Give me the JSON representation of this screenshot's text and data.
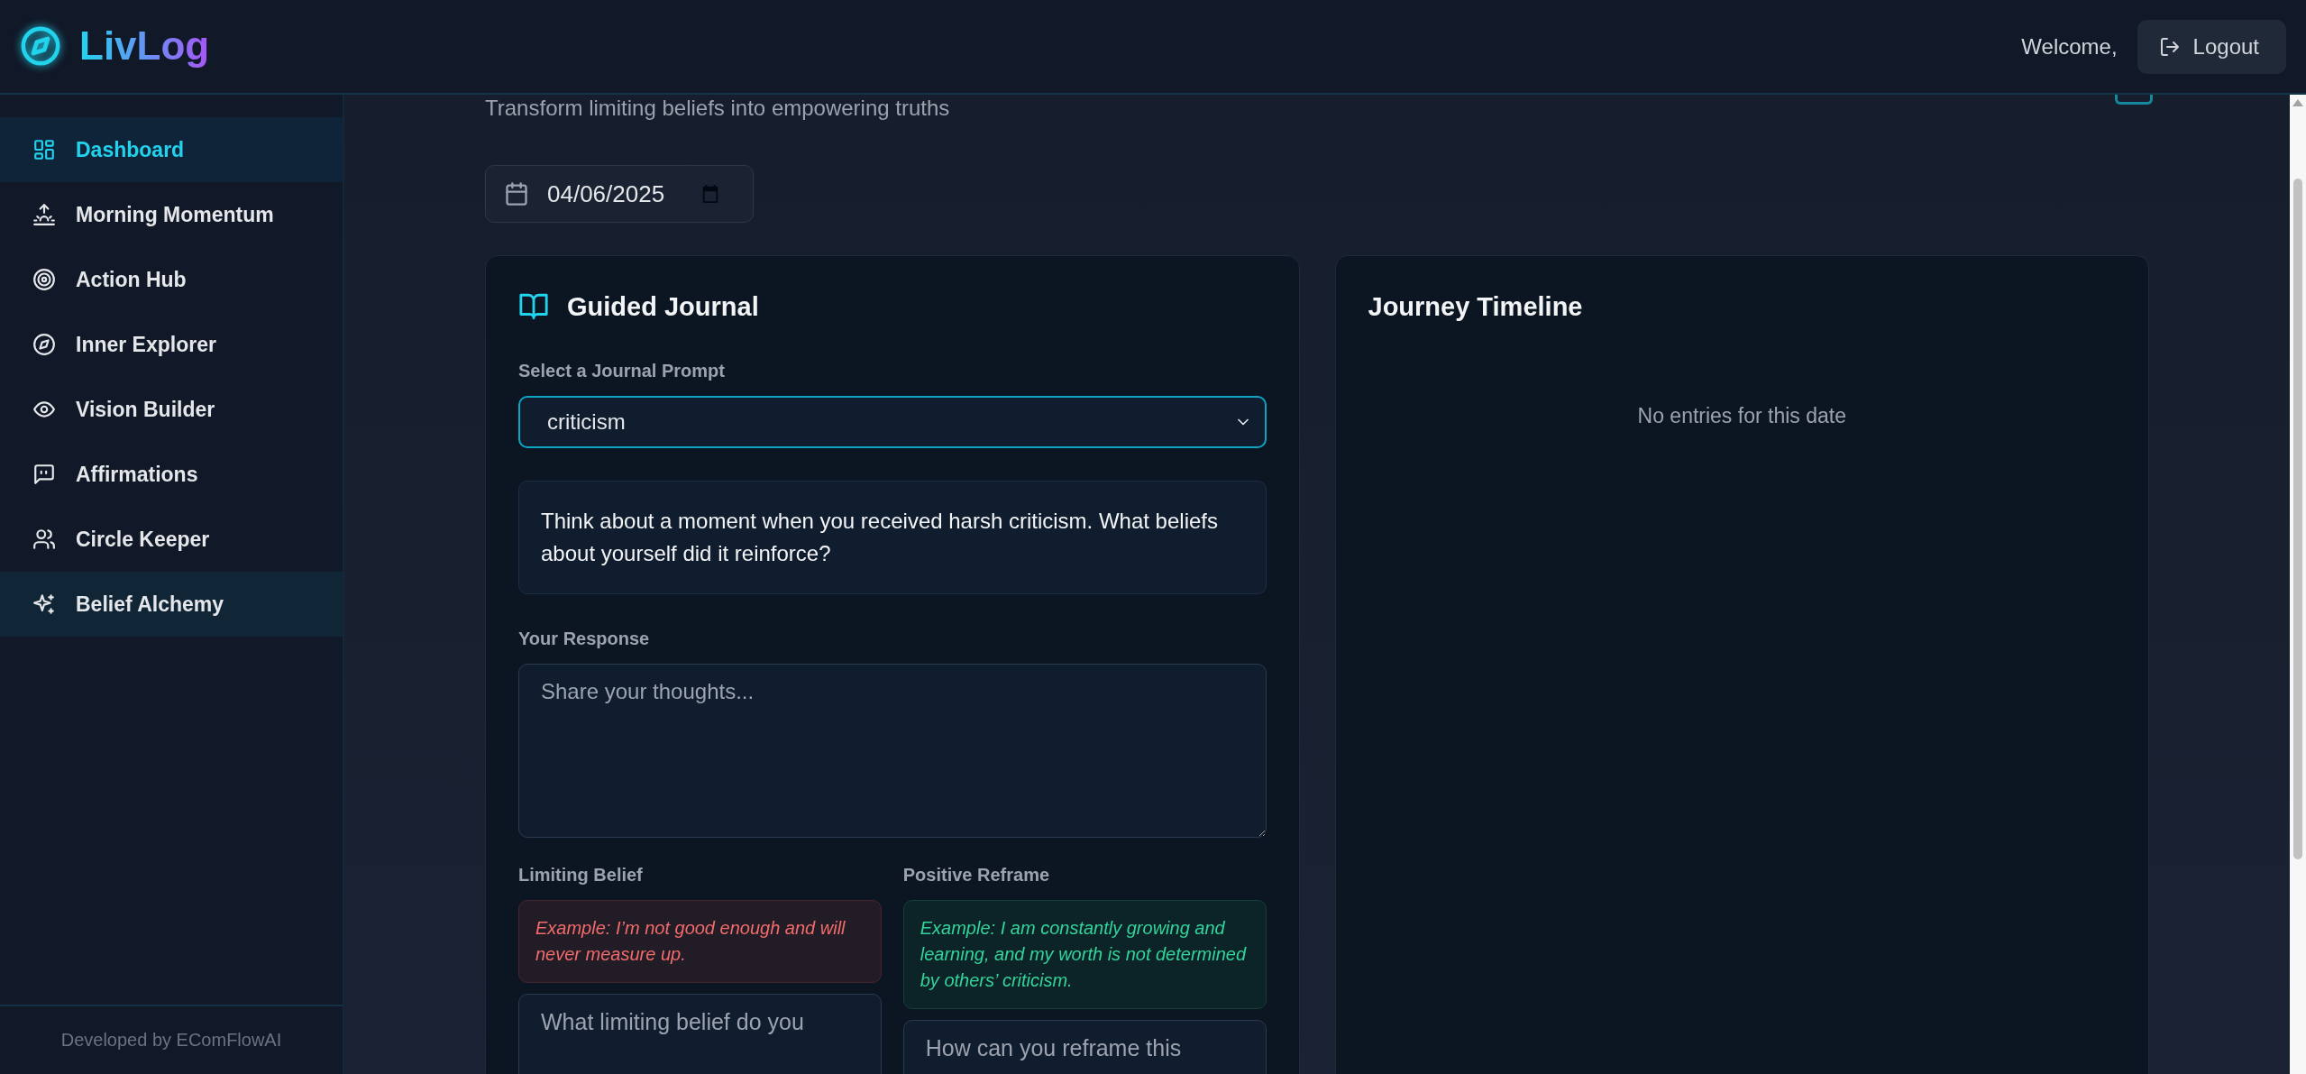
{
  "header": {
    "logo": "LivLog",
    "welcome": "Welcome,",
    "logout": "Logout"
  },
  "sidebar": {
    "items": [
      {
        "label": "Dashboard",
        "selected": true,
        "hovered": false
      },
      {
        "label": "Morning Momentum",
        "selected": false,
        "hovered": false
      },
      {
        "label": "Action Hub",
        "selected": false,
        "hovered": false
      },
      {
        "label": "Inner Explorer",
        "selected": false,
        "hovered": false
      },
      {
        "label": "Vision Builder",
        "selected": false,
        "hovered": false
      },
      {
        "label": "Affirmations",
        "selected": false,
        "hovered": false
      },
      {
        "label": "Circle Keeper",
        "selected": false,
        "hovered": false
      },
      {
        "label": "Belief Alchemy",
        "selected": false,
        "hovered": true
      }
    ],
    "footer": "Developed by EComFlowAI"
  },
  "page": {
    "subtitle": "Transform limiting beliefs into empowering truths",
    "date_field": {
      "value": "04/06/2025"
    }
  },
  "journal": {
    "title": "Guided Journal",
    "prompt_label": "Select a Journal Prompt",
    "prompt_select": {
      "value": "criticism"
    },
    "prompt_text": "Think about a moment when you received harsh criticism. What beliefs about yourself did it reinforce?",
    "response_label": "Your Response",
    "response_field": {
      "placeholder": "Share your thoughts..."
    },
    "columns": [
      {
        "kind": "limiting",
        "label": "Limiting Belief",
        "example": "Example: I’m not good enough and will never measure up.",
        "field": {
          "placeholder": "What limiting belief do you"
        }
      },
      {
        "kind": "reframe",
        "label": "Positive Reframe",
        "example": "Example: I am constantly growing and learning, and my worth is not determined by others’ criticism.",
        "field": {
          "placeholder": "How can you reframe this"
        }
      }
    ]
  },
  "timeline": {
    "title": "Journey Timeline",
    "empty_message": "No entries for this date"
  }
}
